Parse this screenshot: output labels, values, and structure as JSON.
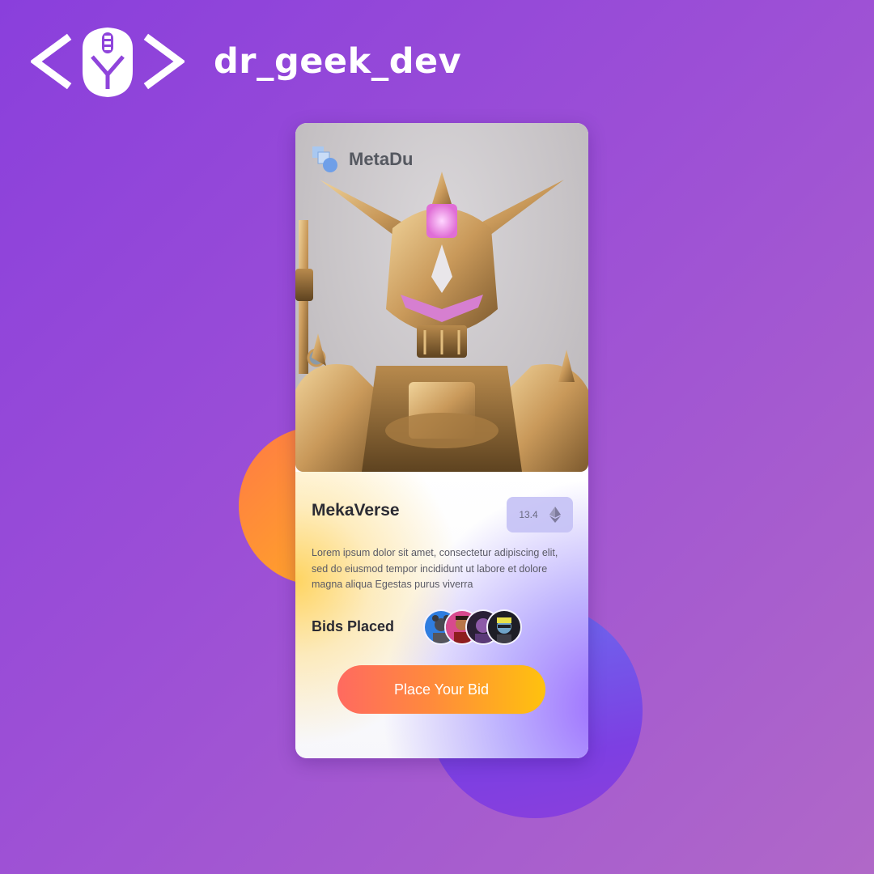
{
  "brand": {
    "name": "dr_geek_dev",
    "logo_icon": "code-mouse-logo-icon"
  },
  "card": {
    "project": {
      "name": "MetaDu",
      "logo_icon": "stacked-squares-logo-icon"
    },
    "image_subject": "golden-robot-artwork",
    "title": "MekaVerse",
    "price": {
      "value": "13.4",
      "currency_icon": "ethereum-icon"
    },
    "description": "Lorem ipsum dolor sit amet, consectetur adipiscing elit, sed do eiusmod tempor incididunt ut labore et dolore magna aliqua Egestas purus viverra",
    "bids": {
      "label": "Bids Placed",
      "avatar_count": 4
    },
    "cta_label": "Place Your Bid"
  },
  "colors": {
    "background_start": "#8a3fdc",
    "background_end": "#b068c8",
    "cta_start": "#ff6a60",
    "cta_end": "#ffc20e",
    "price_badge": "#c4c1f5",
    "heading_text": "#2b2b33"
  }
}
